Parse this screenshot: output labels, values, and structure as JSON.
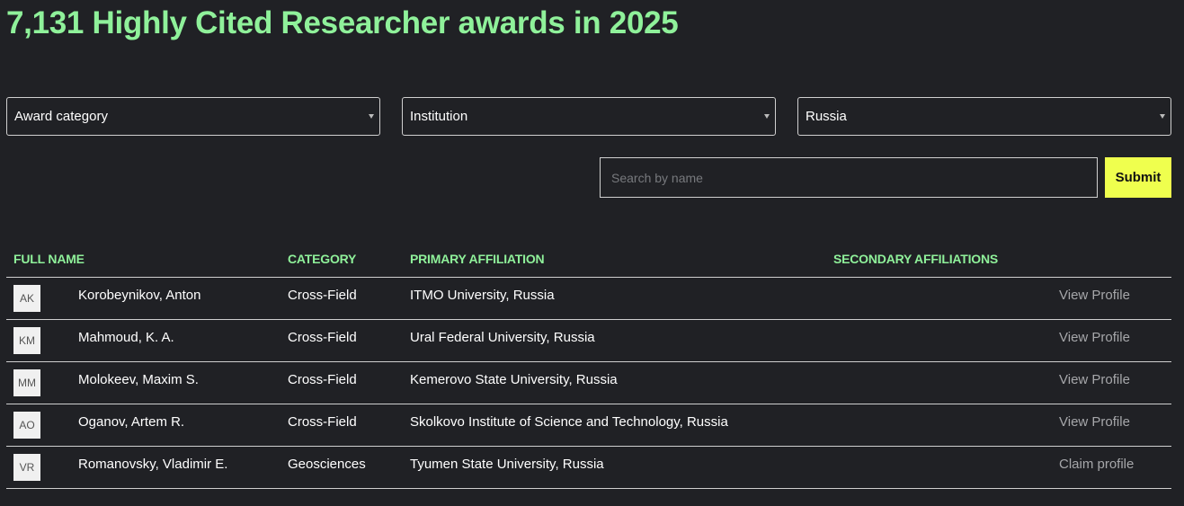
{
  "page": {
    "title": "7,131 Highly Cited Researcher awards in 2025"
  },
  "filters": {
    "award_category": "Award category",
    "institution": "Institution",
    "country": "Russia"
  },
  "search": {
    "placeholder": "Search by name",
    "submit_label": "Submit"
  },
  "table": {
    "columns": [
      "FULL NAME",
      "CATEGORY",
      "PRIMARY AFFILIATION",
      "SECONDARY AFFILIATIONS"
    ],
    "rows": [
      {
        "initials": "AK",
        "name": "Korobeynikov, Anton",
        "category": "Cross-Field",
        "primary": "ITMO University, Russia",
        "secondary": "",
        "action": "View Profile"
      },
      {
        "initials": "KM",
        "name": "Mahmoud, K. A.",
        "category": "Cross-Field",
        "primary": "Ural Federal University, Russia",
        "secondary": "",
        "action": "View Profile"
      },
      {
        "initials": "MM",
        "name": "Molokeev, Maxim S.",
        "category": "Cross-Field",
        "primary": "Kemerovo State University, Russia",
        "secondary": "",
        "action": "View Profile"
      },
      {
        "initials": "AO",
        "name": "Oganov, Artem R.",
        "category": "Cross-Field",
        "primary": "Skolkovo Institute of Science and Technology, Russia",
        "secondary": "",
        "action": "View Profile"
      },
      {
        "initials": "VR",
        "name": "Romanovsky, Vladimir E.",
        "category": "Geosciences",
        "primary": "Tyumen State University, Russia",
        "secondary": "",
        "action": "Claim profile"
      }
    ]
  },
  "colors": {
    "background": "#202125",
    "accent_green": "#8ff19a",
    "submit_yellow": "#efff4e",
    "link_gray": "#a6a7aa"
  }
}
